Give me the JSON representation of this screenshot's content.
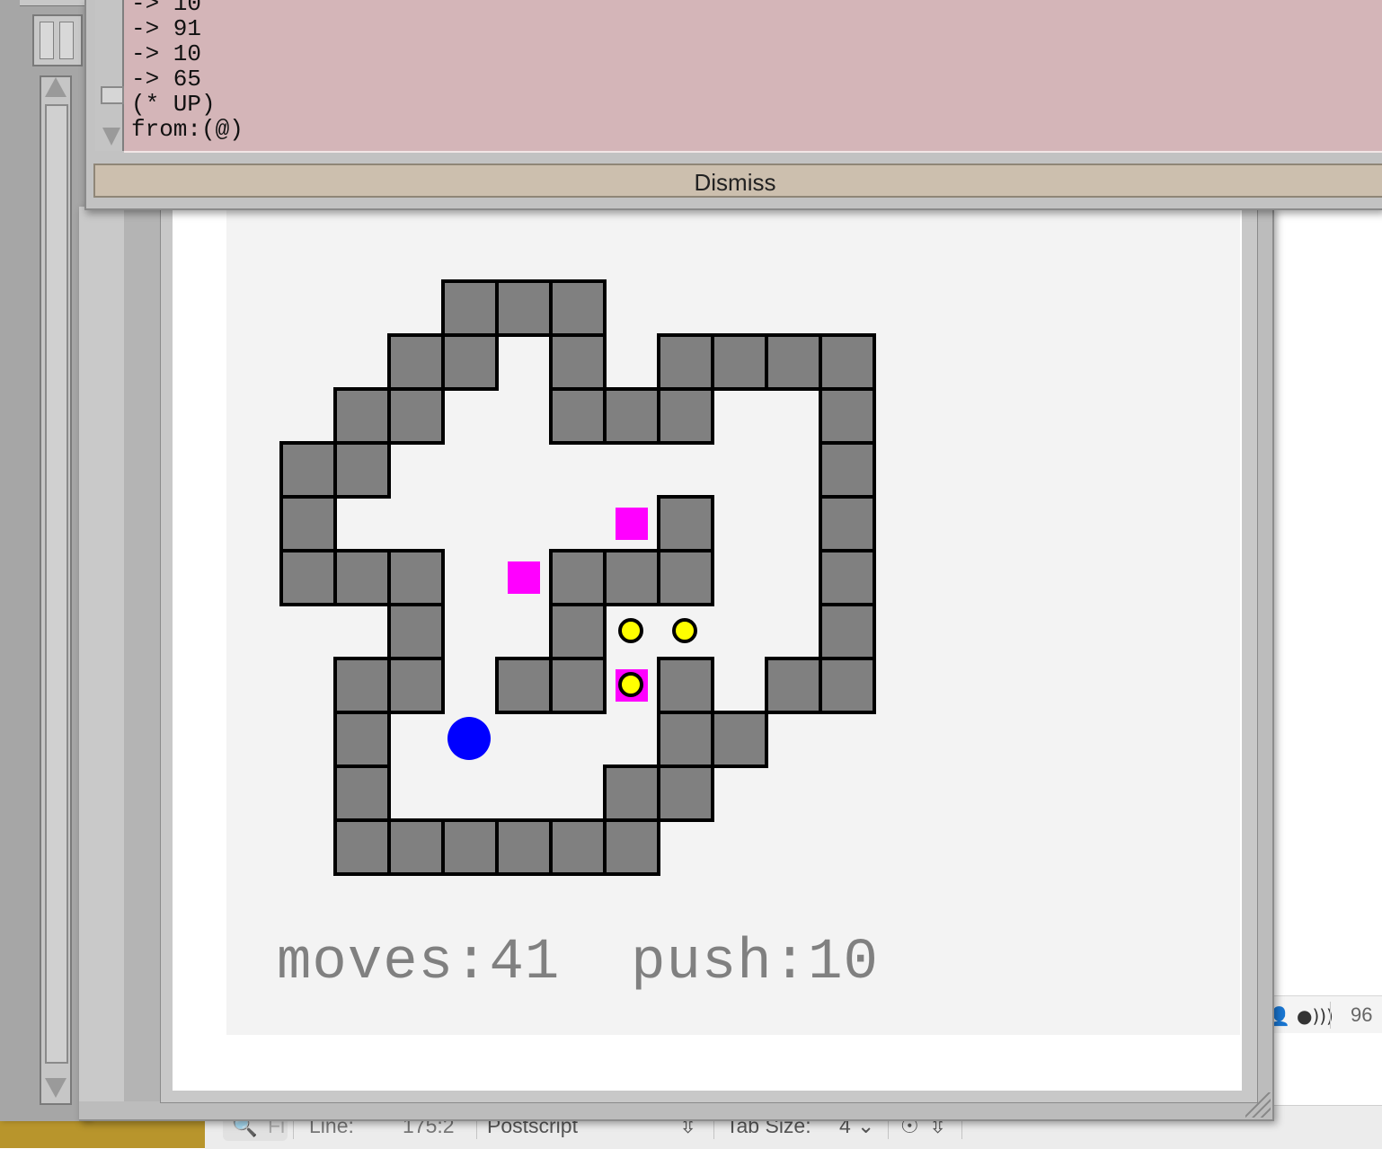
{
  "popup": {
    "lines": [
      "-> 10",
      "-> 91",
      "-> 10",
      "-> 65",
      "(* UP)",
      "from:(@)"
    ],
    "dismiss_label": "Dismiss"
  },
  "game": {
    "stats_moves": "moves:41",
    "stats_push": "push:10",
    "colors": {
      "floor": "#f3f3f3",
      "wall": "#808080",
      "goal": "#ff00ff",
      "box": "#ffff00",
      "player": "#0000ff"
    }
  },
  "editor_status": {
    "search_placeholder": "Fi",
    "line_label": "Line:",
    "line_value": "175:2",
    "language": "Postscript",
    "tab_size_label": "Tab Size:",
    "tab_size_value": "4",
    "zoom_partial": "96"
  }
}
